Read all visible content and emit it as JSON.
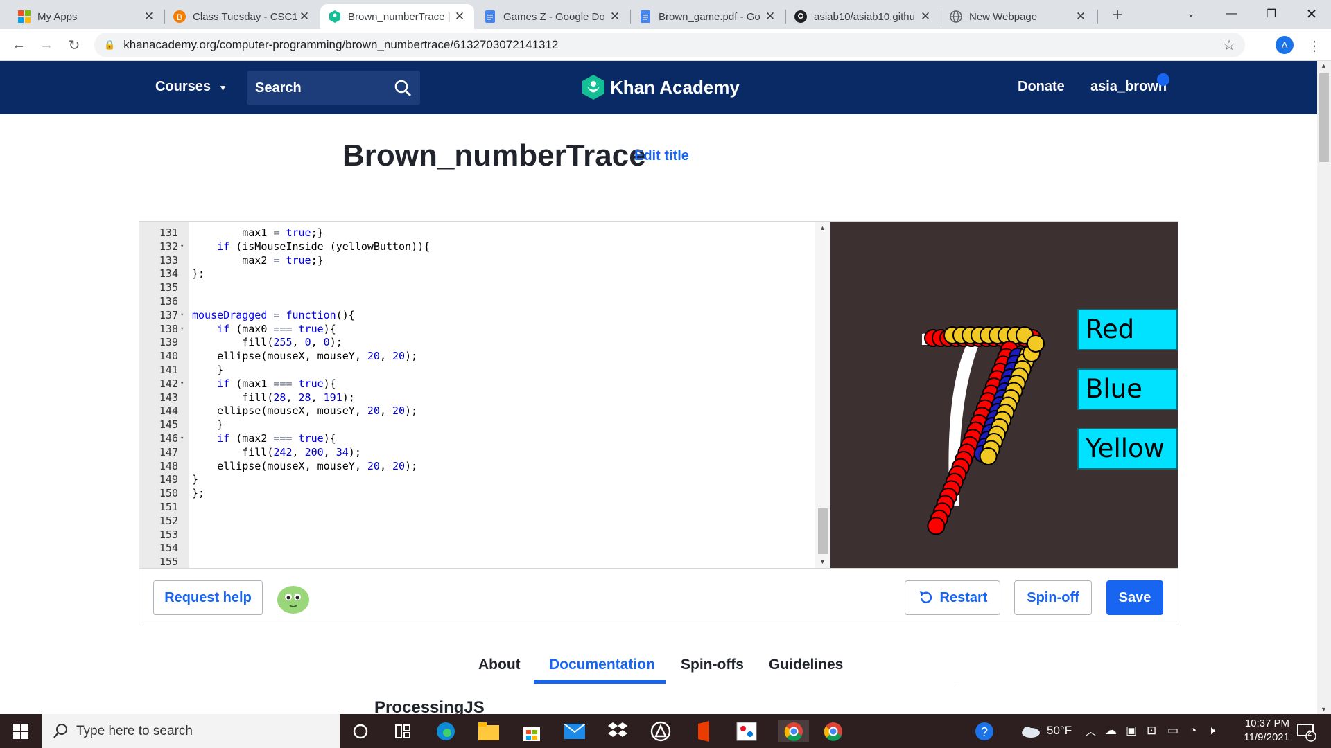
{
  "browser": {
    "tabs": [
      {
        "title": "My Apps"
      },
      {
        "title": "Class Tuesday - CSC1("
      },
      {
        "title": "Brown_numberTrace |"
      },
      {
        "title": "Games Z - Google Do"
      },
      {
        "title": "Brown_game.pdf - Go"
      },
      {
        "title": "asiab10/asiab10.githu"
      },
      {
        "title": "New Webpage"
      }
    ],
    "url": "khanacademy.org/computer-programming/brown_numbertrace/6132703072141312",
    "profile_initial": "A"
  },
  "header": {
    "courses": "Courses",
    "search": "Search",
    "logo": "Khan Academy",
    "donate": "Donate",
    "user": "asia_brown"
  },
  "page": {
    "title": "Brown_numberTrace",
    "edit_title": "Edit title"
  },
  "editor": {
    "lines": [
      {
        "n": "131",
        "fold": false,
        "code": "        max1 = true;}"
      },
      {
        "n": "132",
        "fold": true,
        "code": "    if (isMouseInside (yellowButton)){"
      },
      {
        "n": "133",
        "fold": false,
        "code": "        max2 = true;}"
      },
      {
        "n": "134",
        "fold": false,
        "code": "};"
      },
      {
        "n": "135",
        "fold": false,
        "code": ""
      },
      {
        "n": "136",
        "fold": false,
        "code": ""
      },
      {
        "n": "137",
        "fold": true,
        "code": "mouseDragged = function(){"
      },
      {
        "n": "138",
        "fold": true,
        "code": "    if (max0 === true){"
      },
      {
        "n": "139",
        "fold": false,
        "code": "        fill(255, 0, 0);"
      },
      {
        "n": "140",
        "fold": false,
        "code": "    ellipse(mouseX, mouseY, 20, 20);"
      },
      {
        "n": "141",
        "fold": false,
        "code": "    }"
      },
      {
        "n": "142",
        "fold": true,
        "code": "    if (max1 === true){"
      },
      {
        "n": "143",
        "fold": false,
        "code": "        fill(28, 28, 191);"
      },
      {
        "n": "144",
        "fold": false,
        "code": "    ellipse(mouseX, mouseY, 20, 20);"
      },
      {
        "n": "145",
        "fold": false,
        "code": "    }"
      },
      {
        "n": "146",
        "fold": true,
        "code": "    if (max2 === true){"
      },
      {
        "n": "147",
        "fold": false,
        "code": "        fill(242, 200, 34);"
      },
      {
        "n": "148",
        "fold": false,
        "code": "    ellipse(mouseX, mouseY, 20, 20);"
      },
      {
        "n": "149",
        "fold": false,
        "code": "}"
      },
      {
        "n": "150",
        "fold": false,
        "code": "};"
      },
      {
        "n": "151",
        "fold": false,
        "code": ""
      },
      {
        "n": "152",
        "fold": false,
        "code": ""
      },
      {
        "n": "153",
        "fold": false,
        "code": ""
      },
      {
        "n": "154",
        "fold": false,
        "code": ""
      },
      {
        "n": "155",
        "fold": false,
        "code": ""
      }
    ]
  },
  "canvas": {
    "buttons": [
      {
        "label": "Red"
      },
      {
        "label": "Blue"
      },
      {
        "label": "Yellow"
      }
    ],
    "colors": {
      "red": "#ff0000",
      "blue": "#1c1cbf",
      "yellow": "#f2c822",
      "bg": "#3c3030"
    }
  },
  "actions": {
    "request_help": "Request help",
    "restart": "Restart",
    "spinoff": "Spin-off",
    "save": "Save"
  },
  "tabs": [
    {
      "label": "About"
    },
    {
      "label": "Documentation",
      "active": true
    },
    {
      "label": "Spin-offs"
    },
    {
      "label": "Guidelines"
    }
  ],
  "section_heading": "ProcessingJS",
  "taskbar": {
    "search_placeholder": "Type here to search",
    "weather": "50°F",
    "time": "10:37 PM",
    "date": "11/9/2021",
    "notifications": "2"
  }
}
